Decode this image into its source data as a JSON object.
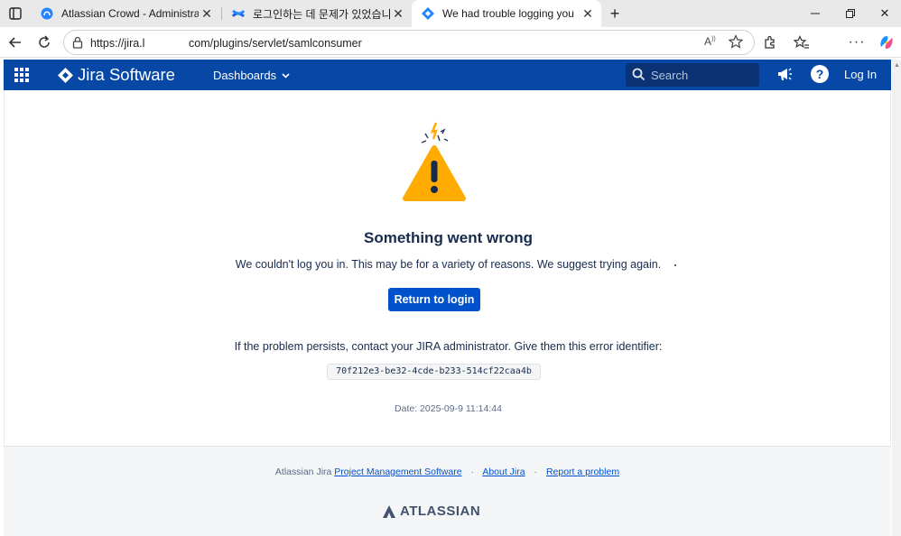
{
  "browser": {
    "tabs": [
      {
        "title": "Atlassian Crowd - Administration",
        "favicon": "crowd-icon"
      },
      {
        "title": "로그인하는 데 문제가 있었습니다",
        "favicon": "confluence-icon"
      },
      {
        "title": "We had trouble logging you in. -",
        "favicon": "jira-icon",
        "active": true
      }
    ],
    "url": "https://jira.l              com/plugins/servlet/samlconsumer"
  },
  "header": {
    "product": "Jira Software",
    "nav_dashboards": "Dashboards",
    "search_placeholder": "Search",
    "help": "?",
    "login": "Log In",
    "color": "#0747a6"
  },
  "error": {
    "heading": "Something went wrong",
    "message": "We couldn't log you in. This may be for a variety of reasons. We suggest trying again.",
    "button": "Return to login",
    "persist": "If the problem persists, contact your JIRA administrator. Give them this error identifier:",
    "identifier": "70f212e3-be32-4cde-b233-514cf22caa4b",
    "date": "Date: 2025-09-9 11:14:44"
  },
  "footer": {
    "prefix": "Atlassian Jira",
    "link_pm": "Project Management Software",
    "link_about": "About Jira",
    "link_report": "Report a problem",
    "brand": "ATLASSIAN"
  }
}
